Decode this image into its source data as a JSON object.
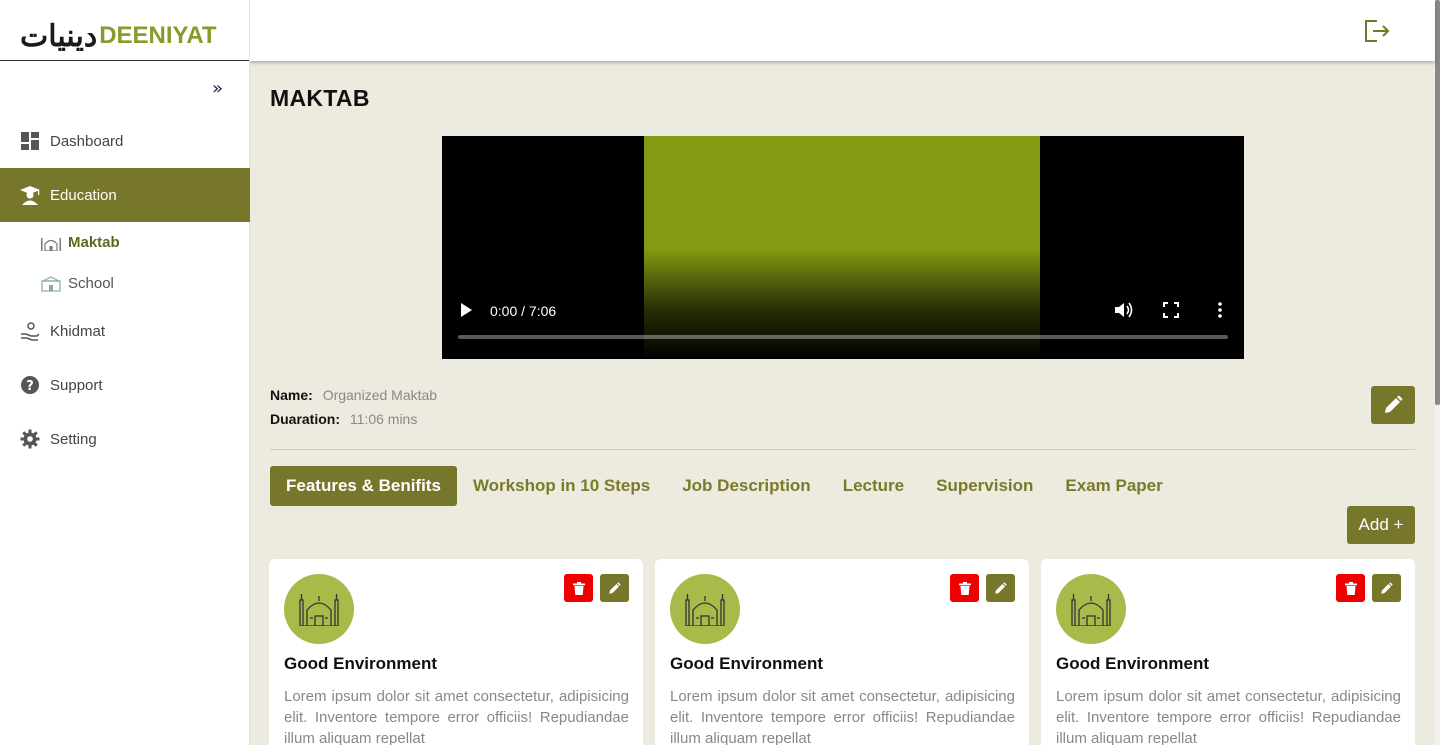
{
  "brand": {
    "arabic": "دینیات",
    "name": "DEENIYAT"
  },
  "sidebar": {
    "items": [
      {
        "label": "Dashboard",
        "icon": "dashboard-icon"
      },
      {
        "label": "Education",
        "icon": "graduate-icon",
        "active": true
      },
      {
        "label": "Khidmat",
        "icon": "helping-hand-icon"
      },
      {
        "label": "Support",
        "icon": "question-icon"
      },
      {
        "label": "Setting",
        "icon": "gear-icon"
      }
    ],
    "sub_items": [
      {
        "label": "Maktab",
        "icon": "mosque-icon",
        "active": true
      },
      {
        "label": "School",
        "icon": "school-icon"
      }
    ]
  },
  "main": {
    "title": "MAKTAB",
    "video": {
      "time": "0:00 / 7:06",
      "progress": 0
    },
    "info": {
      "name_label": "Name:",
      "name_value": "Organized Maktab",
      "duration_label": "Duaration:",
      "duration_value": "11:06 mins"
    },
    "tabs": [
      {
        "label": "Features & Benifits",
        "active": true
      },
      {
        "label": "Workshop in 10 Steps"
      },
      {
        "label": "Job Description"
      },
      {
        "label": "Lecture"
      },
      {
        "label": "Supervision"
      },
      {
        "label": "Exam Paper"
      }
    ],
    "add_label": "Add +",
    "cards": [
      {
        "title": "Good Environment",
        "text": "Lorem ipsum dolor sit amet consectetur, adipisicing elit. Inventore tempore error officiis! Repudiandae illum aliquam repellat"
      },
      {
        "title": "Good Environment",
        "text": "Lorem ipsum dolor sit amet consectetur, adipisicing elit. Inventore tempore error officiis! Repudiandae illum aliquam repellat"
      },
      {
        "title": "Good Environment",
        "text": "Lorem ipsum dolor sit amet consectetur, adipisicing elit. Inventore tempore error officiis! Repudiandae illum aliquam repellat"
      }
    ]
  },
  "colors": {
    "accent": "#76772a",
    "danger": "#ee0000",
    "background": "#edebdf",
    "video_frame": "#849a12",
    "card_icon_bg": "#a7bb4a"
  }
}
